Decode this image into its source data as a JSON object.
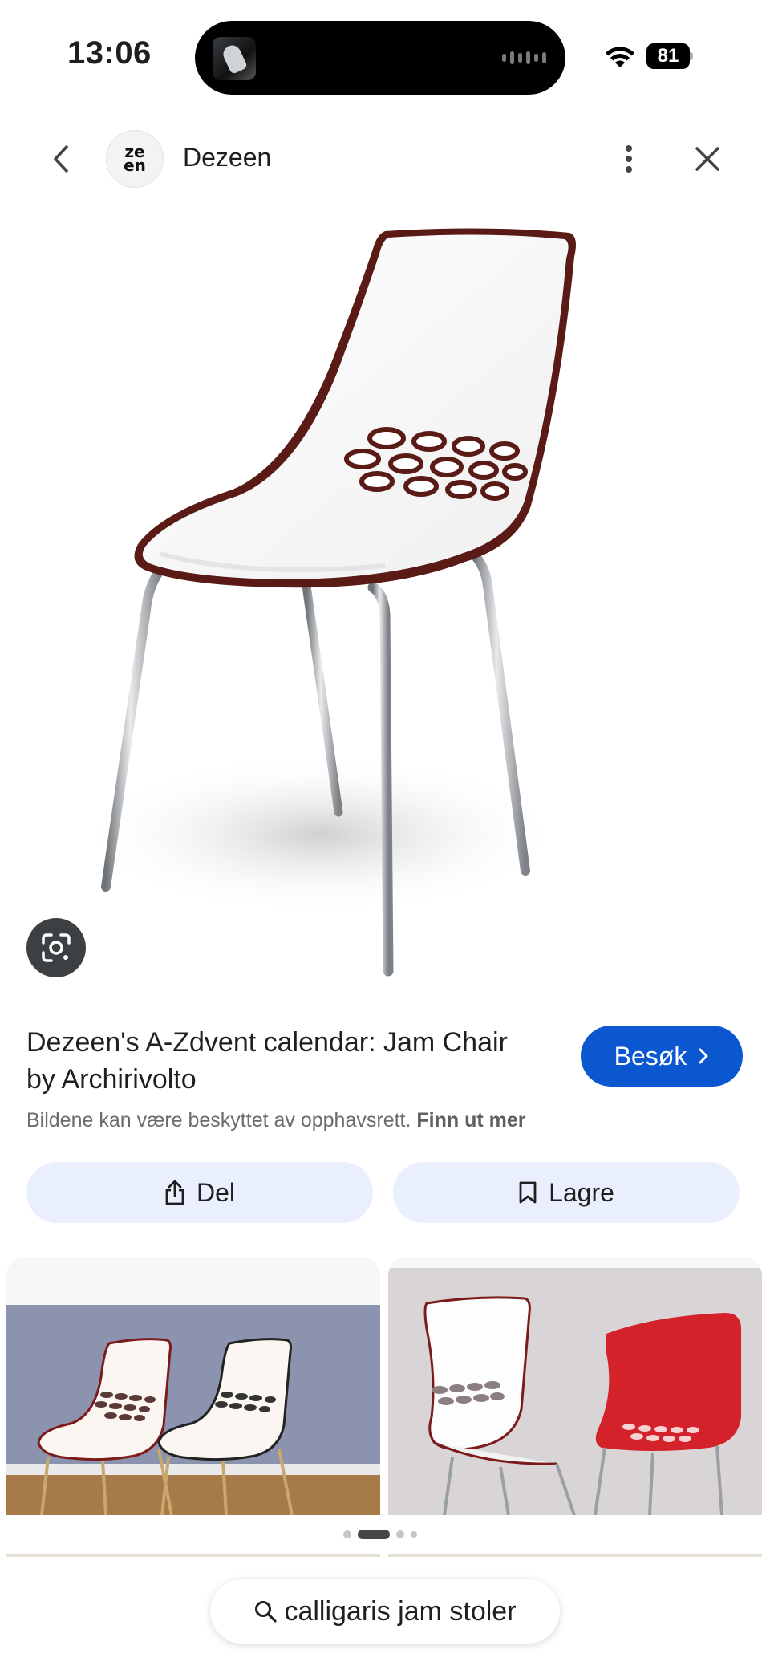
{
  "status_bar": {
    "time": "13:06",
    "battery": "81"
  },
  "source": {
    "avatar_text_line1": "ze",
    "avatar_text_line2": "en",
    "name": "Dezeen"
  },
  "result": {
    "title": "Dezeen's A-Zdvent calendar: Jam Chair by Archirivolto",
    "visit_label": "Besøk",
    "copyright_text": "Bildene kan være beskyttet av opphavsrett.",
    "learn_more_label": "Finn ut mer"
  },
  "actions": {
    "share_label": "Del",
    "save_label": "Lagre"
  },
  "related": {
    "page_count": 4,
    "active_page": 2
  },
  "search_chip": {
    "query": "calligaris jam stoler"
  },
  "icons": {
    "back": "chevron-left-icon",
    "more": "more-vert-icon",
    "close": "close-icon",
    "lens": "google-lens-icon",
    "visit": "chevron-right-icon",
    "share": "share-icon",
    "save": "bookmark-icon",
    "search": "search-icon",
    "wifi": "wifi-icon"
  },
  "colors": {
    "primary_button": "#0b57d0",
    "tonal_button": "#e9effc",
    "lens_button": "#3c4043"
  }
}
